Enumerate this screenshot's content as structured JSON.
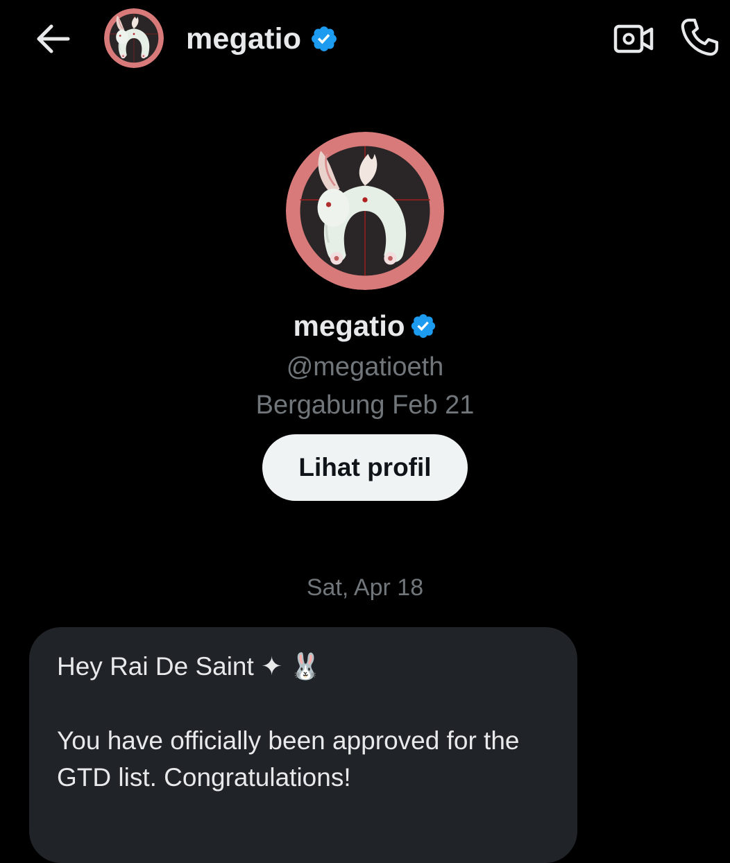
{
  "header": {
    "name": "megatio",
    "verified": true
  },
  "profile": {
    "name": "megatio",
    "handle": "@megatioeth",
    "joined": "Bergabung Feb 21",
    "view_profile_label": "Lihat profil"
  },
  "conversation": {
    "date": "Sat, Apr 18",
    "messages": [
      {
        "greeting": "Hey Rai De Saint ✦ 🐰",
        "body": "You have officially been approved for the GTD list. Congratulations!"
      }
    ]
  },
  "colors": {
    "background": "#000000",
    "text_primary": "#e7e9ea",
    "text_secondary": "#71767b",
    "verified_badge": "#1d9bf0",
    "bubble": "#202327",
    "button_bg": "#eff3f4",
    "avatar_ring": "#d97a7a"
  },
  "icons": {
    "back": "arrow-left-icon",
    "video": "video-camera-icon",
    "call": "phone-icon",
    "verified": "verified-badge-icon"
  }
}
